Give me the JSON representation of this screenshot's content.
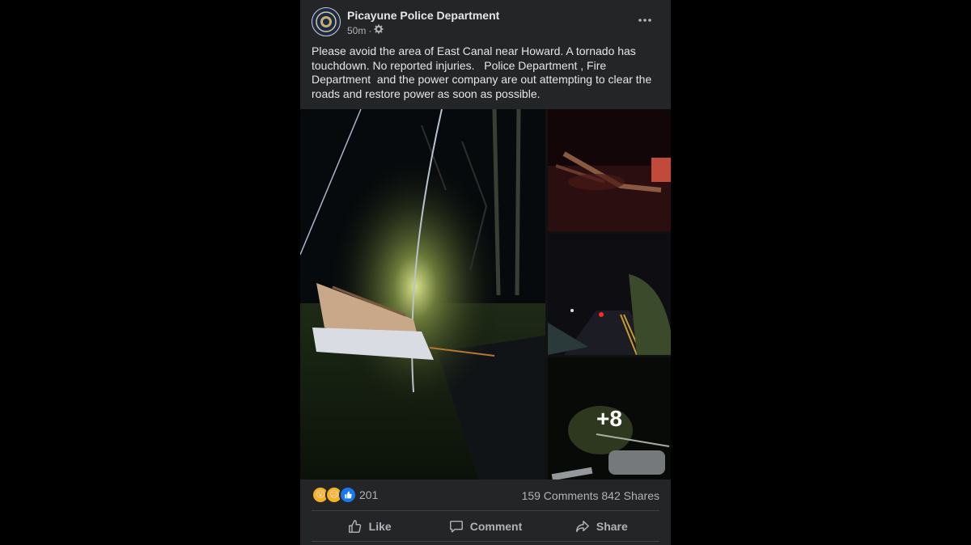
{
  "post": {
    "page_name": "Picayune Police Department",
    "time": "50m",
    "separator": "·",
    "privacy_icon": "gear-icon",
    "more_icon": "more-options-icon",
    "text": "Please avoid the area of East Canal near Howard. A tornado has touchdown. No reported injuries.   Police Department , Fire Department  and the power company are out attempting to clear the roads and restore power as soon as possible."
  },
  "media": {
    "extra_count": "+8"
  },
  "stats": {
    "reactions": [
      {
        "type": "wow",
        "glyph": "😮"
      },
      {
        "type": "sad",
        "glyph": "😥"
      },
      {
        "type": "like",
        "glyph": "👍"
      }
    ],
    "reaction_count": "201",
    "comments": "159 Comments",
    "shares": "842 Shares"
  },
  "actions": {
    "like": "Like",
    "comment": "Comment",
    "share": "Share"
  },
  "colors": {
    "card_bg": "#242526",
    "page_bg": "#000000",
    "text": "#e4e6eb",
    "secondary_text": "#b0b3b8",
    "like_blue": "#1877f2",
    "reaction_yellow": "#f7b125"
  }
}
